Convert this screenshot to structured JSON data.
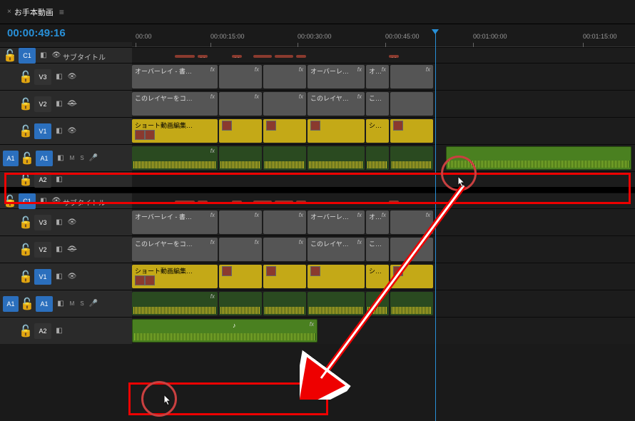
{
  "header": {
    "tab": "お手本動画",
    "timecode": "00:00:49:16"
  },
  "ruler": [
    "00:00",
    "00:00:15:00",
    "00:00:30:00",
    "00:00:45:00",
    "00:01:00:00",
    "00:01:15:00"
  ],
  "tracks": {
    "c1": {
      "label": "C1",
      "sub": "サブタイトル"
    },
    "v3": {
      "label": "V3",
      "clip": "オーバーレイ - 書…",
      "clip2": "オーバーレ…",
      "clip3": "オ…"
    },
    "v2": {
      "label": "V2",
      "clip": "このレイヤーをコ…",
      "clip2": "このレイヤ…",
      "clip3": "こ…"
    },
    "v1": {
      "label": "V1",
      "clip": "ショート動画編集…",
      "clip2": "シ…"
    },
    "a1": {
      "label": "A1",
      "src": "A1",
      "m": "M",
      "s": "S"
    },
    "a2": {
      "label": "A2"
    }
  },
  "fx": "fx",
  "cap": "Y…",
  "music": "♪"
}
